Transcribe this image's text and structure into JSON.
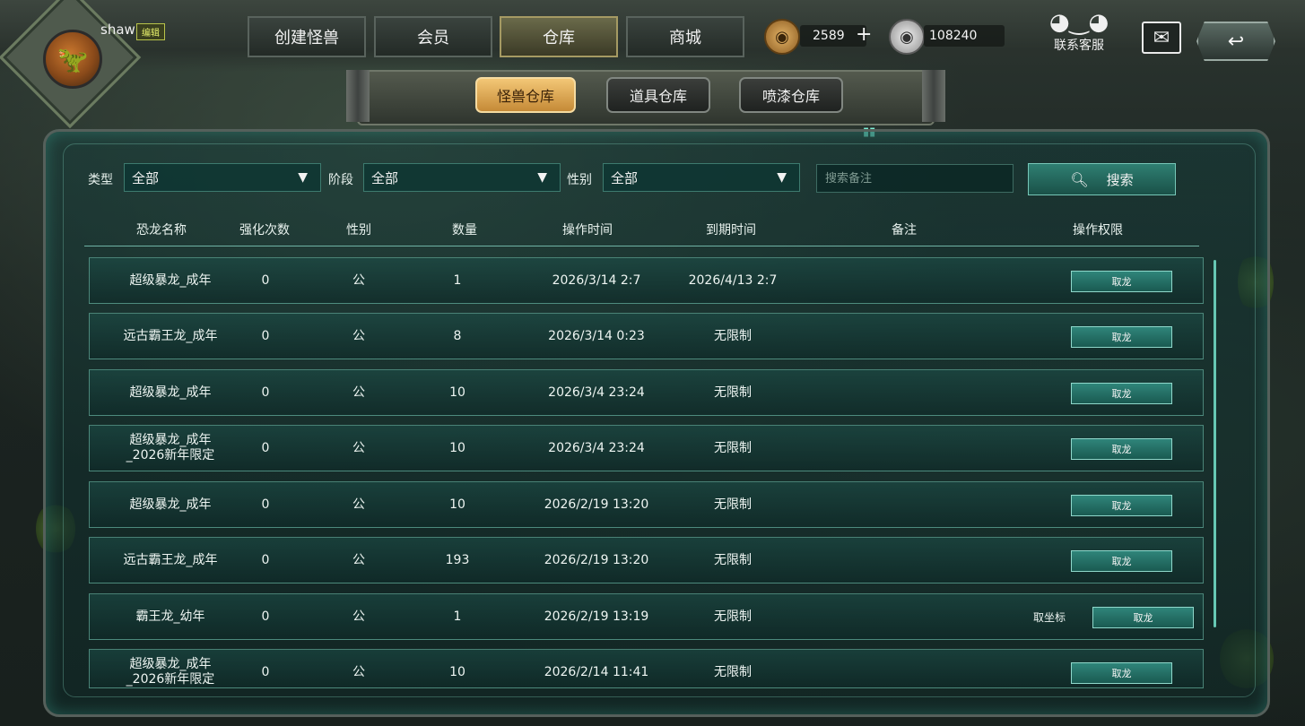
{
  "user": {
    "name": "shaw",
    "edit_label": "编辑"
  },
  "nav": {
    "tabs": [
      {
        "label": "创建怪兽"
      },
      {
        "label": "会员"
      },
      {
        "label": "仓库"
      },
      {
        "label": "商城"
      }
    ],
    "active_index": 2
  },
  "currency": {
    "gold": "2589",
    "silver": "108240"
  },
  "support": {
    "label": "联系客服"
  },
  "sub_tabs": {
    "tabs": [
      {
        "label": "怪兽仓库"
      },
      {
        "label": "道具仓库"
      },
      {
        "label": "喷漆仓库"
      }
    ],
    "active_index": 0
  },
  "filters": {
    "type": {
      "label": "类型",
      "value": "全部"
    },
    "stage": {
      "label": "阶段",
      "value": "全部"
    },
    "gender": {
      "label": "性别",
      "value": "全部"
    },
    "search_placeholder": "搜索备注",
    "search_button": "搜索"
  },
  "table": {
    "headers": [
      "恐龙名称",
      "强化次数",
      "性别",
      "数量",
      "操作时间",
      "到期时间",
      "备注",
      "操作权限"
    ],
    "rows": [
      {
        "name": "超级暴龙_成年",
        "enhance": "0",
        "gender": "公",
        "qty": "1",
        "op_time": "2026/3/14 2:7",
        "expire": "2026/4/13 2:7",
        "note": "",
        "coord": "",
        "action": "取龙"
      },
      {
        "name": "远古霸王龙_成年",
        "enhance": "0",
        "gender": "公",
        "qty": "8",
        "op_time": "2026/3/14 0:23",
        "expire": "无限制",
        "note": "",
        "coord": "",
        "action": "取龙"
      },
      {
        "name": "超级暴龙_成年",
        "enhance": "0",
        "gender": "公",
        "qty": "10",
        "op_time": "2026/3/4 23:24",
        "expire": "无限制",
        "note": "",
        "coord": "",
        "action": "取龙"
      },
      {
        "name": "超级暴龙_成年_2026新年限定",
        "enhance": "0",
        "gender": "公",
        "qty": "10",
        "op_time": "2026/3/4 23:24",
        "expire": "无限制",
        "note": "",
        "coord": "",
        "action": "取龙"
      },
      {
        "name": "超级暴龙_成年",
        "enhance": "0",
        "gender": "公",
        "qty": "10",
        "op_time": "2026/2/19 13:20",
        "expire": "无限制",
        "note": "",
        "coord": "",
        "action": "取龙"
      },
      {
        "name": "远古霸王龙_成年",
        "enhance": "0",
        "gender": "公",
        "qty": "193",
        "op_time": "2026/2/19 13:20",
        "expire": "无限制",
        "note": "",
        "coord": "",
        "action": "取龙"
      },
      {
        "name": "霸王龙_幼年",
        "enhance": "0",
        "gender": "公",
        "qty": "1",
        "op_time": "2026/2/19 13:19",
        "expire": "无限制",
        "note": "",
        "coord": "取坐标",
        "action": "取龙"
      },
      {
        "name": "超级暴龙_成年_2026新年限定",
        "enhance": "0",
        "gender": "公",
        "qty": "10",
        "op_time": "2026/2/14 11:41",
        "expire": "无限制",
        "note": "",
        "coord": "",
        "action": "取龙"
      }
    ]
  },
  "icons": {
    "avatar": "t-rex-avatar-icon",
    "gold_coin": "gold-dino-coin-icon",
    "silver_coin": "silver-dino-coin-icon",
    "add": "plus-icon",
    "support": "headset-icon",
    "mail": "mail-icon",
    "back": "back-arrow-icon",
    "search": "search-icon",
    "dropdown": "caret-down-icon"
  },
  "colors": {
    "accent_teal": "#2f7f72",
    "active_tab_gold": "#f3c776"
  }
}
